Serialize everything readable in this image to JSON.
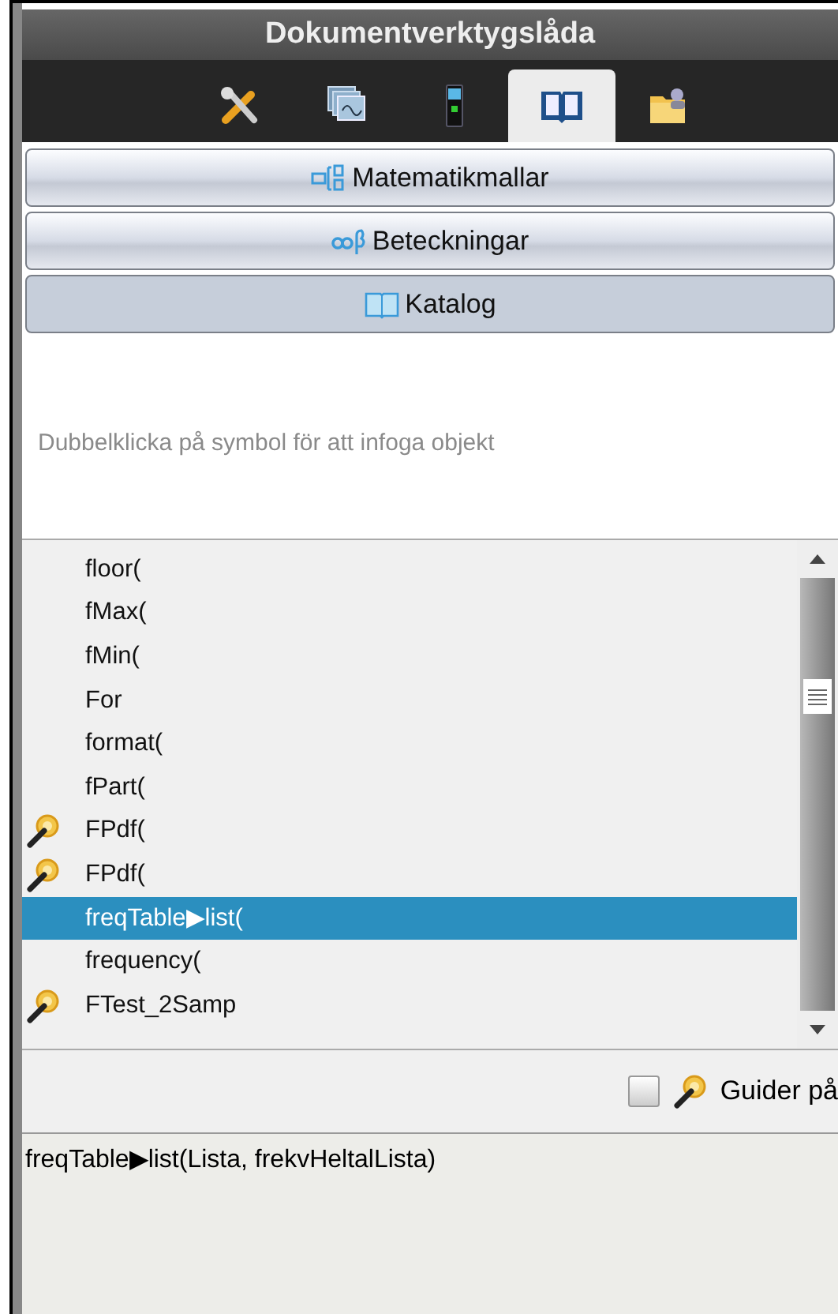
{
  "window": {
    "title": "Dokumentverktygslåda"
  },
  "tabs": [
    {
      "kind": "tools",
      "selected": false
    },
    {
      "kind": "pages",
      "selected": false
    },
    {
      "kind": "device",
      "selected": false
    },
    {
      "kind": "book",
      "selected": true
    },
    {
      "kind": "folder",
      "selected": false
    }
  ],
  "sections": [
    {
      "label": "Matematikmallar",
      "kind": "templates",
      "selected": false
    },
    {
      "label": "Beteckningar",
      "kind": "symbols",
      "selected": false
    },
    {
      "label": "Katalog",
      "kind": "catalog",
      "selected": true
    }
  ],
  "hint": "Dubbelklicka på symbol för att infoga objekt",
  "catalog": [
    {
      "label": "floor(",
      "wizard": false,
      "selected": false
    },
    {
      "label": "fMax(",
      "wizard": false,
      "selected": false
    },
    {
      "label": "fMin(",
      "wizard": false,
      "selected": false
    },
    {
      "label": "For",
      "wizard": false,
      "selected": false
    },
    {
      "label": "format(",
      "wizard": false,
      "selected": false
    },
    {
      "label": "fPart(",
      "wizard": false,
      "selected": false
    },
    {
      "label": "FPdf(",
      "wizard": true,
      "selected": false
    },
    {
      "label": "FPdf(",
      "wizard": true,
      "selected": false
    },
    {
      "label": "freqTable▶list(",
      "wizard": false,
      "selected": true
    },
    {
      "label": "frequency(",
      "wizard": false,
      "selected": false
    },
    {
      "label": "FTest_2Samp",
      "wizard": true,
      "selected": false
    }
  ],
  "wizards_option": {
    "label": "Guider på",
    "checked": false
  },
  "syntax": "freqTable▶list(Lista, frekvHeltalLista)"
}
